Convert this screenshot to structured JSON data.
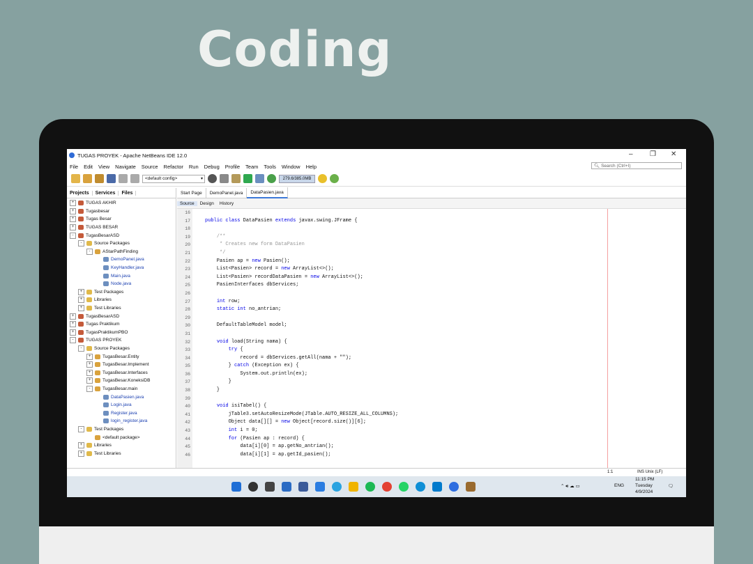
{
  "slide": {
    "title": "Coding"
  },
  "ide": {
    "window_title": "TUGAS PROYEK - Apache NetBeans IDE 12.0",
    "menu": [
      "File",
      "Edit",
      "View",
      "Navigate",
      "Source",
      "Refactor",
      "Run",
      "Debug",
      "Profile",
      "Team",
      "Tools",
      "Window",
      "Help"
    ],
    "search_placeholder": "Search (Ctrl+I)",
    "config": "<default config>",
    "memory": "279.6/385.0MB",
    "panel_tabs": [
      "Projects",
      "Services",
      "Files"
    ],
    "tree": [
      {
        "label": "TUGAS AKHIR",
        "indent": 0,
        "kind": "project",
        "exp": "+"
      },
      {
        "label": "Tugasbesar",
        "indent": 0,
        "kind": "project",
        "exp": "+"
      },
      {
        "label": "Tugas Besar",
        "indent": 0,
        "kind": "project",
        "exp": "+"
      },
      {
        "label": "TUGAS BESAR",
        "indent": 0,
        "kind": "project",
        "exp": "+"
      },
      {
        "label": "TugasBesarASD",
        "indent": 0,
        "kind": "project",
        "exp": "-"
      },
      {
        "label": "Source Packages",
        "indent": 1,
        "kind": "folder",
        "exp": "-"
      },
      {
        "label": "AStarPathFinding",
        "indent": 2,
        "kind": "package",
        "exp": "-"
      },
      {
        "label": "DemoPanel.java",
        "indent": 3,
        "kind": "java",
        "exp": ""
      },
      {
        "label": "KeyHandler.java",
        "indent": 3,
        "kind": "java",
        "exp": ""
      },
      {
        "label": "Main.java",
        "indent": 3,
        "kind": "java",
        "exp": ""
      },
      {
        "label": "Node.java",
        "indent": 3,
        "kind": "java",
        "exp": ""
      },
      {
        "label": "Test Packages",
        "indent": 1,
        "kind": "folder",
        "exp": "+"
      },
      {
        "label": "Libraries",
        "indent": 1,
        "kind": "folder",
        "exp": "+"
      },
      {
        "label": "Test Libraries",
        "indent": 1,
        "kind": "folder",
        "exp": "+"
      },
      {
        "label": "TugasBesarASD",
        "indent": 0,
        "kind": "project",
        "exp": "+"
      },
      {
        "label": "Tugas Praktikum",
        "indent": 0,
        "kind": "project",
        "exp": "+"
      },
      {
        "label": "TugasPraktikumPBO",
        "indent": 0,
        "kind": "project",
        "exp": "+"
      },
      {
        "label": "TUGAS PROYEK",
        "indent": 0,
        "kind": "project",
        "exp": "-"
      },
      {
        "label": "Source Packages",
        "indent": 1,
        "kind": "folder",
        "exp": "-"
      },
      {
        "label": "TugasBesar.Entity",
        "indent": 2,
        "kind": "package",
        "exp": "+"
      },
      {
        "label": "TugasBesar.Implement",
        "indent": 2,
        "kind": "package",
        "exp": "+"
      },
      {
        "label": "TugasBesar.Interfaces",
        "indent": 2,
        "kind": "package",
        "exp": "+"
      },
      {
        "label": "TugasBesar.KoneksiDB",
        "indent": 2,
        "kind": "package",
        "exp": "+"
      },
      {
        "label": "TugasBesar.main",
        "indent": 2,
        "kind": "package",
        "exp": "-"
      },
      {
        "label": "DataPasien.java",
        "indent": 3,
        "kind": "java",
        "exp": ""
      },
      {
        "label": "Login.java",
        "indent": 3,
        "kind": "java",
        "exp": ""
      },
      {
        "label": "Register.java",
        "indent": 3,
        "kind": "java",
        "exp": ""
      },
      {
        "label": "login_register.java",
        "indent": 3,
        "kind": "java",
        "exp": ""
      },
      {
        "label": "Test Packages",
        "indent": 1,
        "kind": "folder",
        "exp": "-"
      },
      {
        "label": "<default package>",
        "indent": 2,
        "kind": "package",
        "exp": ""
      },
      {
        "label": "Libraries",
        "indent": 1,
        "kind": "folder",
        "exp": "+"
      },
      {
        "label": "Test Libraries",
        "indent": 1,
        "kind": "folder",
        "exp": "+"
      }
    ],
    "file_tabs": [
      "Start Page",
      "DemoPanel.java",
      "DataPasien.java"
    ],
    "editor_views": [
      "Source",
      "Design",
      "History"
    ],
    "line_numbers": [
      "16",
      "17",
      "18",
      "19",
      "20",
      "21",
      "22",
      "23",
      "24",
      "25",
      "26",
      "27",
      "28",
      "29",
      "30",
      "31",
      "32",
      "33",
      "34",
      "35",
      "36",
      "37",
      "38",
      "39",
      "40",
      "41",
      "42",
      "43",
      "44",
      "45",
      "46"
    ],
    "code_lines": [
      "",
      "public class DataPasien extends javax.swing.JFrame {",
      "",
      "    /**",
      "     * Creates new form DataPasien",
      "     */",
      "    Pasien ap = new Pasien();",
      "    List<Pasien> record = new ArrayList<>();",
      "    List<Pasien> recordDataPasien = new ArrayList<>();",
      "    PasienInterfaces dbServices;",
      "",
      "    int row;",
      "    static int no_antrian;",
      "",
      "    DefaultTableModel model;",
      "",
      "    void load(String nama) {",
      "        try {",
      "            record = dbServices.getAll(nama + \"\");",
      "        } catch (Exception ex) {",
      "            System.out.println(ex);",
      "        }",
      "    }",
      "",
      "    void isiTabel() {",
      "        jTable3.setAutoResizeMode(JTable.AUTO_RESIZE_ALL_COLUMNS);",
      "        Object data[][] = new Object[record.size()][6];",
      "        int i = 0;",
      "        for (Pasien ap : record) {",
      "            data[i][0] = ap.getNo_antrian();",
      "            data[i][1] = ap.getId_pasien();"
    ],
    "status": {
      "position": "1:1",
      "mode": "INS Unix (LF)"
    },
    "taskbar": {
      "time": "11:15 PM",
      "day": "Tuesday",
      "date": "4/9/2024",
      "lang": "ENG"
    }
  },
  "colors": {
    "background": "#86a1a0",
    "monitor": "#111111",
    "taskbar": "#dfe7ee",
    "keyword": "#0000e6",
    "comment": "#969696",
    "field": "#009900"
  }
}
